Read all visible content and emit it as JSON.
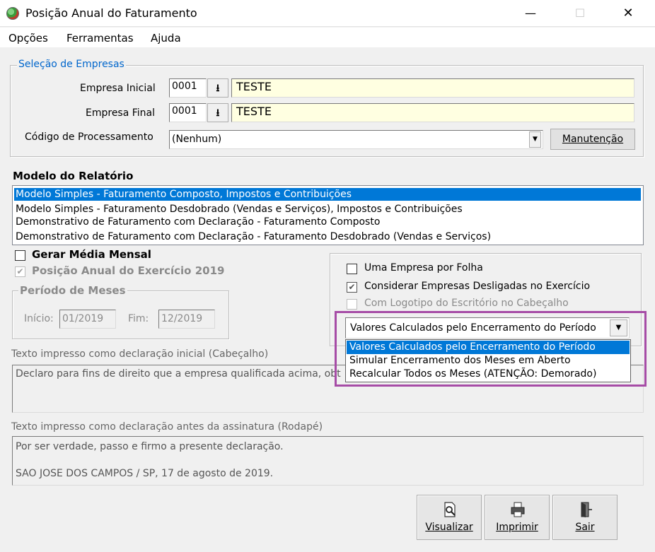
{
  "window": {
    "title": "Posição Anual do Faturamento",
    "minimize_glyph": "—",
    "maximize_glyph": "☐",
    "close_glyph": "✕"
  },
  "menu": [
    "Opções",
    "Ferramentas",
    "Ajuda"
  ],
  "empresas": {
    "group_label": "Seleção de Empresas",
    "inicial_label": "Empresa Inicial",
    "inicial_code": "0001",
    "inicial_name": "TESTE",
    "final_label": "Empresa Final",
    "final_code": "0001",
    "final_name": "TESTE",
    "codigo_label": "Código de Processamento",
    "codigo_value": "(Nenhum)",
    "manutencao_label": "Manutenção"
  },
  "modelo": {
    "heading": "Modelo do Relatório",
    "items": [
      "Modelo Simples - Faturamento Composto, Impostos e Contribuições",
      "Modelo Simples - Faturamento Desdobrado (Vendas e Serviços), Impostos e Contribuições",
      "Demonstrativo de Faturamento com Declaração - Faturamento Composto",
      "Demonstrativo de Faturamento com Declaração - Faturamento Desdobrado (Vendas e Serviços)"
    ],
    "selected_index": 0
  },
  "options_left": {
    "gerar_media": "Gerar Média Mensal",
    "gerar_media_checked": false,
    "posicao_anual": "Posição Anual do Exercício 2019",
    "posicao_anual_checked": true
  },
  "periodo": {
    "group_label": "Período de Meses",
    "inicio_label": "Início:",
    "inicio_value": "01/2019",
    "fim_label": "Fim:",
    "fim_value": "12/2019"
  },
  "options_right": {
    "uma_empresa": "Uma Empresa por Folha",
    "uma_empresa_checked": false,
    "considerar": "Considerar Empresas Desligadas no Exercício",
    "considerar_checked": true,
    "logotipo": "Com Logotipo do Escritório no Cabeçalho",
    "logotipo_checked": false
  },
  "valores_combo": {
    "selected": "Valores Calculados pelo Encerramento do Período",
    "options": [
      "Valores Calculados pelo Encerramento do Período",
      "Simular Encerramento dos Meses em Aberto",
      "Recalcular Todos os Meses (ATENÇÃO: Demorado)"
    ],
    "highlight_color": "#a64ca6"
  },
  "cabecalho": {
    "label": "Texto impresso como declaração inicial (Cabeçalho)",
    "text": "Declaro para fins de direito que a empresa qualificada acima, obt"
  },
  "rodape": {
    "label": "Texto impresso como declaração antes da assinatura (Rodapé)",
    "line1": "Por ser verdade, passo e firmo a presente declaração.",
    "line2": "SAO JOSE DOS CAMPOS / SP, 17 de agosto de 2019."
  },
  "buttons": {
    "visualizar": "Visualizar",
    "imprimir": "Imprimir",
    "sair": "Sair"
  },
  "colors": {
    "selection": "#0078d7",
    "group_label": "#0066cc",
    "yellow_field": "#ffffe1"
  }
}
